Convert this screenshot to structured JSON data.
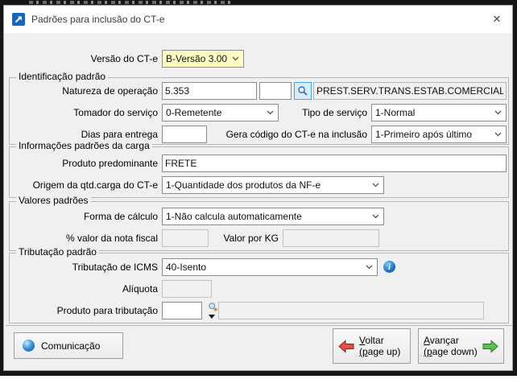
{
  "window": {
    "title": "Padrões para inclusão do CT-e"
  },
  "form": {
    "versao": {
      "label": "Versão do CT-e",
      "value": "B-Versão 3.00"
    },
    "identificacao": {
      "legend": "Identificação padrão",
      "natureza_label": "Natureza de operação",
      "natureza_codigo": "5.353",
      "natureza_sufixo": "",
      "natureza_descricao": "PREST.SERV.TRANS.ESTAB.COMERCIAL",
      "tomador_label": "Tomador do serviço",
      "tomador_value": "0-Remetente",
      "tipo_label": "Tipo de serviço",
      "tipo_value": "1-Normal",
      "dias_label": "Dias para entrega",
      "dias_value": "",
      "gera_label": "Gera código do CT-e na inclusão",
      "gera_value": "1-Primeiro após último"
    },
    "carga": {
      "legend": "Informações padrões da carga",
      "produto_label": "Produto predominante",
      "produto_value": "FRETE",
      "origem_label": "Origem da qtd.carga do CT-e",
      "origem_value": "1-Quantidade dos produtos da NF-e"
    },
    "valores": {
      "legend": "Valores padrões",
      "forma_label": "Forma de cálculo",
      "forma_value": "1-Não calcula automaticamente",
      "pct_label": "% valor da nota fiscal",
      "pct_value": "",
      "kg_label": "Valor por KG",
      "kg_value": ""
    },
    "tributacao": {
      "legend": "Tributação padrão",
      "icms_label": "Tributação de ICMS",
      "icms_value": "40-Isento",
      "aliquota_label": "Alíquota",
      "aliquota_value": "",
      "produto_label": "Produto para tributação",
      "produto_codigo": "",
      "produto_descricao": ""
    }
  },
  "buttons": {
    "comunicacao": "Comunicação",
    "voltar": "Voltar",
    "voltar_sub": "(page up)",
    "avancar": "Avançar",
    "avancar_sub": "(page down)"
  },
  "icons": {
    "close": "✕",
    "info": "i"
  },
  "colors": {
    "highlight_field": "#ffffc4",
    "accent_blue": "#1566c0",
    "arrow_red": "#e04e4e",
    "arrow_green": "#5dc353"
  }
}
